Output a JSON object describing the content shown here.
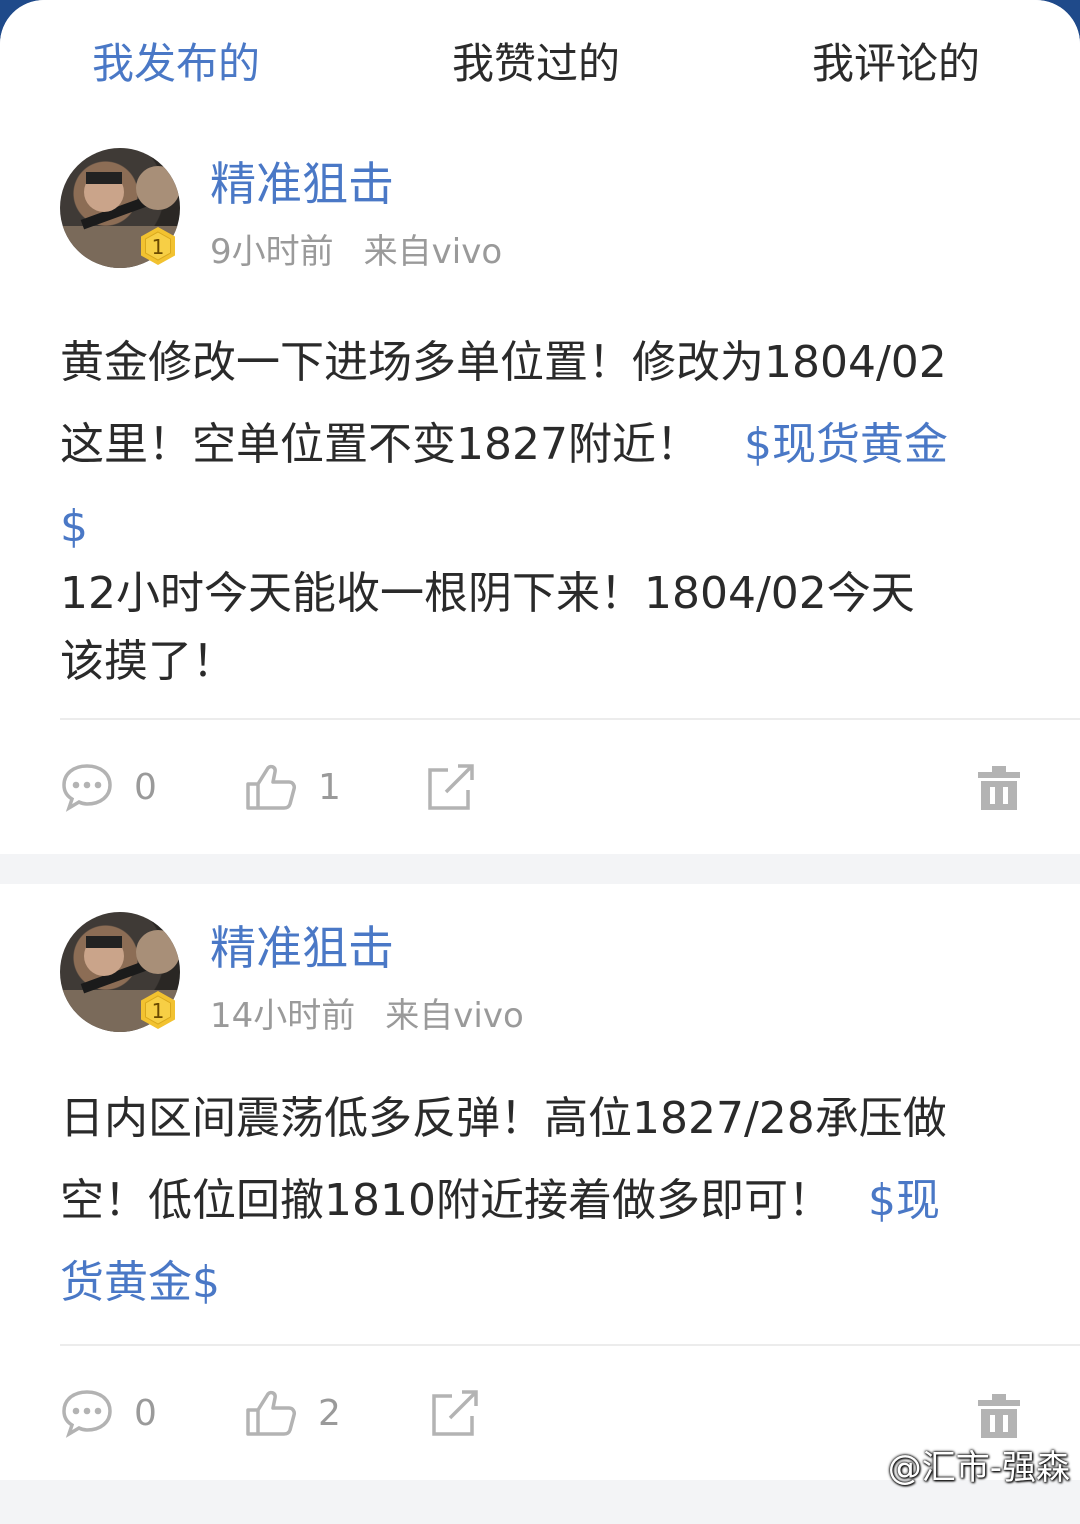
{
  "tabs": [
    {
      "label": "我发布的",
      "active": true
    },
    {
      "label": "我赞过的",
      "active": false
    },
    {
      "label": "我评论的",
      "active": false
    }
  ],
  "posts": [
    {
      "author": "精准狙击",
      "level": "1",
      "time": "9小时前",
      "source": "来自vivo",
      "body_line1": "黄金修改一下进场多单位置！修改为1804/02",
      "body_line2": "这里！空单位置不变1827附近！",
      "body_tag": "$现货黄金",
      "body_tag_end": "$",
      "body_line3": "12小时今天能收一根阴下来！1804/02今天",
      "body_line4": "该摸了！",
      "comments": "0",
      "likes": "1"
    },
    {
      "author": "精准狙击",
      "level": "1",
      "time": "14小时前",
      "source": "来自vivo",
      "body_line1": "日内区间震荡低多反弹！高位1827/28承压做",
      "body_line2": "空！低位回撤1810附近接着做多即可！",
      "body_tag": "$现",
      "body_tag_end": "货黄金$",
      "comments": "0",
      "likes": "2"
    }
  ],
  "watermark": "@汇市-强森",
  "colors": {
    "accent": "#4a78c6",
    "badge": "#f2c230",
    "muted": "#9a9a9a"
  }
}
